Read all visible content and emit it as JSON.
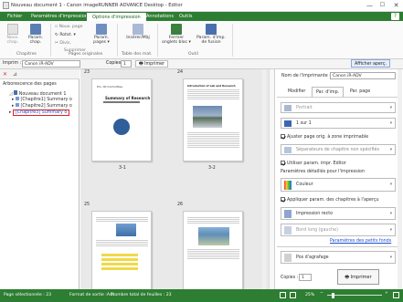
{
  "window": {
    "title": "Nouveau document 1 - Canon imageRUNNER ADVANCE Desktop - Editor",
    "min": "—",
    "max": "☐",
    "close": "✕"
  },
  "ribbon_tabs": [
    "Fichier",
    "Paramètres d'impression",
    "Options d'impression",
    "Annotations",
    "Outils"
  ],
  "ribbon": {
    "chapters": {
      "group": "Chapitres",
      "nouv_chap": "Nouv. chap.",
      "param_chap": "Param. chap."
    },
    "pages": {
      "group": "Pages originales",
      "nouv_page": "Nouv. page",
      "rotat": "Rotat. ▾",
      "divis": "Divis.",
      "supprimer": "Supprimer",
      "param_pages": "Param. pages ▾"
    },
    "table": {
      "group": "Table des mat.",
      "inserer": "Insérer/Màj"
    },
    "outil": {
      "group": "Outil",
      "fermer": "Fermer onglets bloc ▾",
      "param_fusion": "Param. d'imp. de fusion"
    },
    "afficher": "Afficher aperç."
  },
  "toolbar2": {
    "imprim_label": "Imprim :",
    "imprim_value": "Canon iR-ADV",
    "copies_label": "Copies :",
    "copies_value": "1",
    "imprimer": "Imprimer"
  },
  "left": {
    "root": "Arborescence des pages",
    "items": [
      "Nouveau document 1",
      "[Chapitre1] Summary o",
      "[Chapitre2] Summary o",
      "[Chapitre3] Summary o"
    ]
  },
  "middle": {
    "pages": [
      {
        "num": "23",
        "label": "3-1",
        "heading": "Summary of Research",
        "cap": "Pro. 00 Committee"
      },
      {
        "num": "24",
        "label": "3-2",
        "heading": "Introduction of Lab and Research"
      },
      {
        "num": "25",
        "label": ""
      },
      {
        "num": "26",
        "label": ""
      }
    ]
  },
  "right": {
    "printer_label": "Nom de l'imprimante :",
    "printer_value": "Canon iR-ADV",
    "tabs": [
      "Modifier",
      "Par. d'imp.",
      "Par. page"
    ],
    "orientation": "Portrait",
    "n_up": "1 sur 1",
    "fit_page": "Ajuster page orig. à zone imprimable",
    "separator": "Séparateurs de chapitre non spécifiés",
    "use_editor": "Utiliser param. impr. Editor",
    "detailed": "Paramètres détaillés pour l'impression",
    "color": "Couleur",
    "chapter_apply": "Appliquer param. des chapitres à l'aperçu",
    "duplex": "Impression recto",
    "binding": "Bord long (gauche)",
    "finishing": "Paramètres des petits fonds",
    "feed": "Pos d'agrafage",
    "copies_label": "Copies :",
    "copies_value": "1",
    "print": "Imprimer"
  },
  "status": {
    "selected": "Page sélectionnée : 23",
    "output": "Format de sortie :A4",
    "sheets": "Nombre total de feuilles : 23",
    "zoom": "25%"
  },
  "colors": {
    "accent": "#2d7d32",
    "select_red": "#e02020"
  }
}
